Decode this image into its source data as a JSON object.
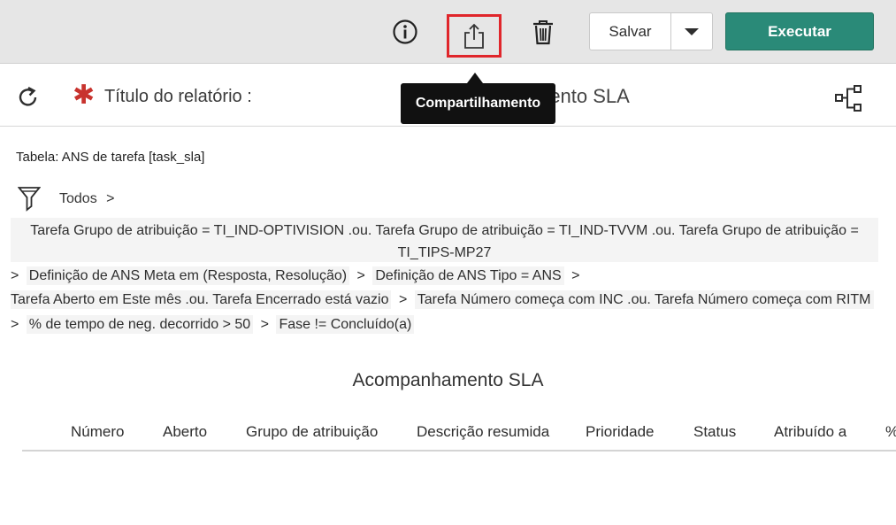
{
  "toolbar": {
    "info_icon": "info-circle-icon",
    "share_icon": "share-upload-icon",
    "trash_icon": "trash-icon",
    "save_label": "Salvar",
    "run_label": "Executar",
    "accent_color": "#2a8a78",
    "highlight_color": "#e0262b"
  },
  "tooltip": {
    "text": "Compartilhamento"
  },
  "header": {
    "title_label": "Título do relatório :",
    "title_value_visible": "mento SLA"
  },
  "filters": {
    "table_label": "Tabela: ANS de tarefa [task_sla]",
    "root": "Todos",
    "conditions": [
      "Tarefa Grupo de atribuição = TI_IND-OPTIVISION .ou. Tarefa Grupo de atribuição = TI_IND-TVVM .ou. Tarefa Grupo de atribuição = TI_TIPS-MP27",
      "Definição de ANS Meta em (Resposta, Resolução)",
      "Definição de ANS Tipo = ANS",
      "Tarefa Aberto em Este mês .ou. Tarefa Encerrado está vazio",
      "Tarefa Número começa com INC .ou. Tarefa Número começa com RITM",
      "% de tempo de neg. decorrido > 50",
      "Fase != Concluído(a)"
    ],
    "separator": ">"
  },
  "report": {
    "title": "Acompanhamento SLA",
    "columns": [
      "Número",
      "Aberto",
      "Grupo de atribuição",
      "Descrição resumida",
      "Prioridade",
      "Status",
      "Atribuído a",
      "%"
    ]
  }
}
